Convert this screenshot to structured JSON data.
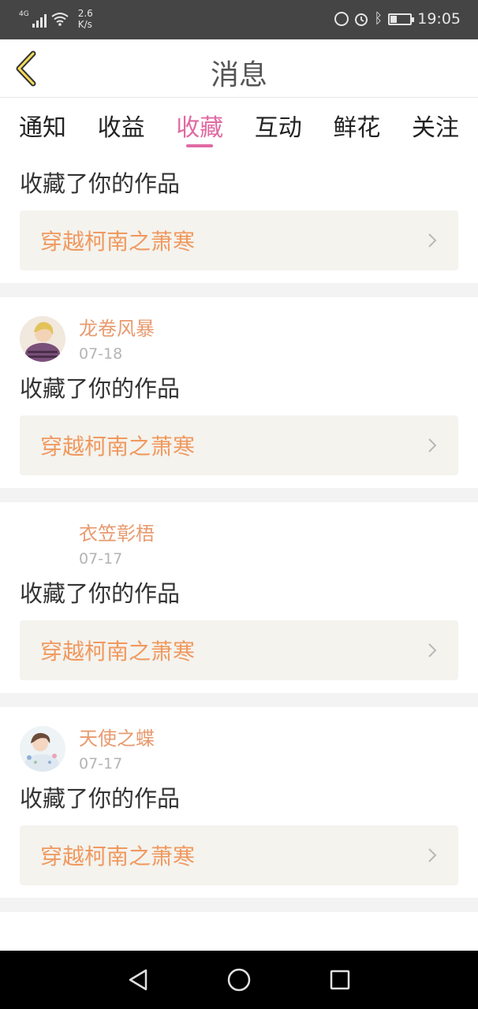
{
  "status_bar": {
    "network": "4G",
    "speed": "2.6",
    "speed_unit": "K/s",
    "time": "19:05",
    "icons": [
      "signal-icon",
      "wifi-icon",
      "data-saver-icon",
      "alarm-icon",
      "bluetooth-icon",
      "battery-icon"
    ]
  },
  "header": {
    "title": "消息",
    "back_icon": "chevron-left-icon"
  },
  "tabs": [
    {
      "label": "通知"
    },
    {
      "label": "收益"
    },
    {
      "label": "收藏"
    },
    {
      "label": "互动"
    },
    {
      "label": "鲜花"
    },
    {
      "label": "关注"
    }
  ],
  "active_tab": "收藏",
  "feed": {
    "items": [
      {
        "username": "",
        "date": "",
        "action": "收藏了你的作品",
        "work_title": "穿越柯南之萧寒"
      },
      {
        "username": "龙卷风暴",
        "date": "07-18",
        "action": "收藏了你的作品",
        "work_title": "穿越柯南之萧寒"
      },
      {
        "username": "衣笠彰梧",
        "date": "07-17",
        "action": "收藏了你的作品",
        "work_title": "穿越柯南之萧寒"
      },
      {
        "username": "天使之蝶",
        "date": "07-17",
        "action": "收藏了你的作品",
        "work_title": "穿越柯南之萧寒"
      }
    ]
  },
  "nav_bar": {
    "buttons": [
      "back-triangle-icon",
      "home-circle-icon",
      "recents-square-icon"
    ]
  },
  "colors": {
    "accent": "#e06aa3",
    "username": "#e89a6e",
    "work_title": "#f0995f",
    "link_bg": "#f4f3ee",
    "status_bar_bg": "#454545"
  }
}
